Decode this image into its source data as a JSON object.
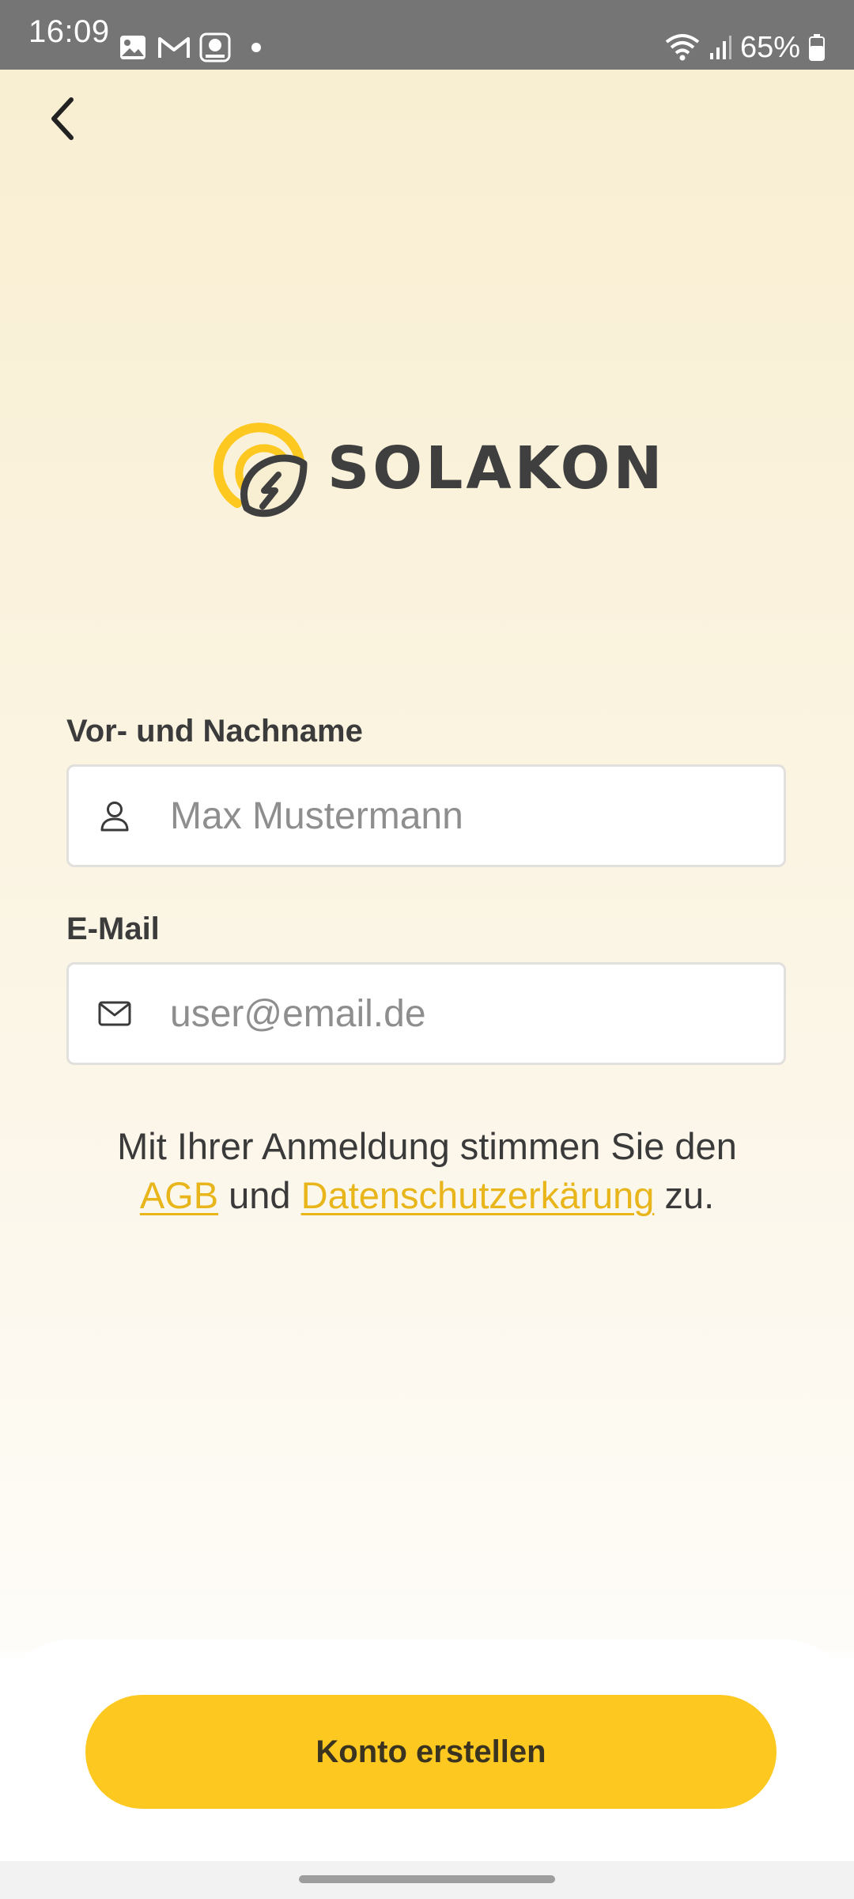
{
  "status_bar": {
    "time": "16:09",
    "battery": "65%",
    "icons": [
      "gallery-icon",
      "gmail-icon",
      "media-app-icon",
      "notification-dot-icon",
      "wifi-icon",
      "signal-icon",
      "battery-icon"
    ]
  },
  "navigation": {
    "back_icon": "chevron-left-icon"
  },
  "brand": {
    "name": "SOLAKON",
    "colors": {
      "yellow": "#fdc921",
      "dark": "#3f3f3f"
    }
  },
  "form": {
    "name": {
      "label": "Vor- und Nachname",
      "placeholder": "Max Mustermann",
      "value": "",
      "icon": "person-icon"
    },
    "email": {
      "label": "E-Mail",
      "placeholder": "user@email.de",
      "value": "",
      "icon": "envelope-icon"
    }
  },
  "consent": {
    "prefix": "Mit Ihrer Anmeldung stimmen Sie den",
    "agb_link": "AGB",
    "middle": "und",
    "privacy_link": "Datenschutzerkärung",
    "suffix": "zu.",
    "link_color": "#e8b51a"
  },
  "actions": {
    "submit_label": "Konto erstellen",
    "button_color": "#fdc921"
  }
}
